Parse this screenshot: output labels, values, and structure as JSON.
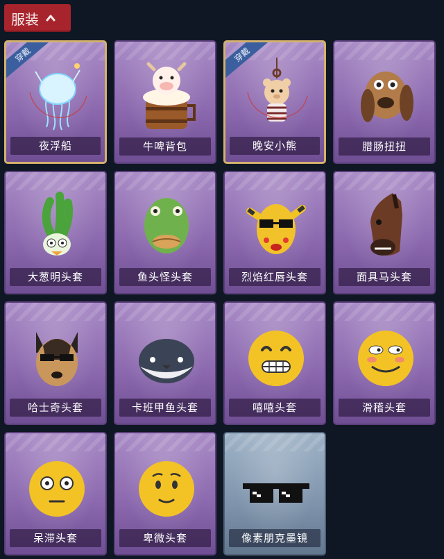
{
  "header": {
    "label": "服装",
    "chevron_icon": "chevron-up-icon",
    "color": "#a8242c"
  },
  "worn_badge": "穿戴",
  "items": [
    {
      "name": "夜浮船",
      "worn": true,
      "icon": "jellyfish-backpack-icon"
    },
    {
      "name": "牛啤背包",
      "worn": false,
      "icon": "cow-beer-barrel-icon"
    },
    {
      "name": "晚安小熊",
      "worn": true,
      "icon": "teddy-bear-pendant-icon"
    },
    {
      "name": "腊肠扭扭",
      "worn": false,
      "icon": "sausage-dog-mask-icon"
    },
    {
      "name": "大葱明头套",
      "worn": false,
      "icon": "scallion-mask-icon"
    },
    {
      "name": "鱼头怪头套",
      "worn": false,
      "icon": "fish-head-mask-icon"
    },
    {
      "name": "烈焰红唇头套",
      "worn": false,
      "icon": "yellow-hood-sunglasses-mask-icon"
    },
    {
      "name": "面具马头套",
      "worn": false,
      "icon": "horse-mask-icon"
    },
    {
      "name": "哈士奇头套",
      "worn": false,
      "icon": "husky-mask-icon"
    },
    {
      "name": "卡班甲鱼头套",
      "worn": false,
      "icon": "whale-mask-icon"
    },
    {
      "name": "嘻嘻头套",
      "worn": false,
      "icon": "grinning-emoji-mask-icon"
    },
    {
      "name": "滑稽头套",
      "worn": false,
      "icon": "funny-emoji-mask-icon"
    },
    {
      "name": "呆滞头套",
      "worn": false,
      "icon": "stunned-emoji-mask-icon"
    },
    {
      "name": "卑微头套",
      "worn": false,
      "icon": "humble-emoji-mask-icon"
    },
    {
      "name": "像素朋克墨镜",
      "worn": false,
      "icon": "pixel-sunglasses-icon",
      "rarity": "blue"
    }
  ]
}
